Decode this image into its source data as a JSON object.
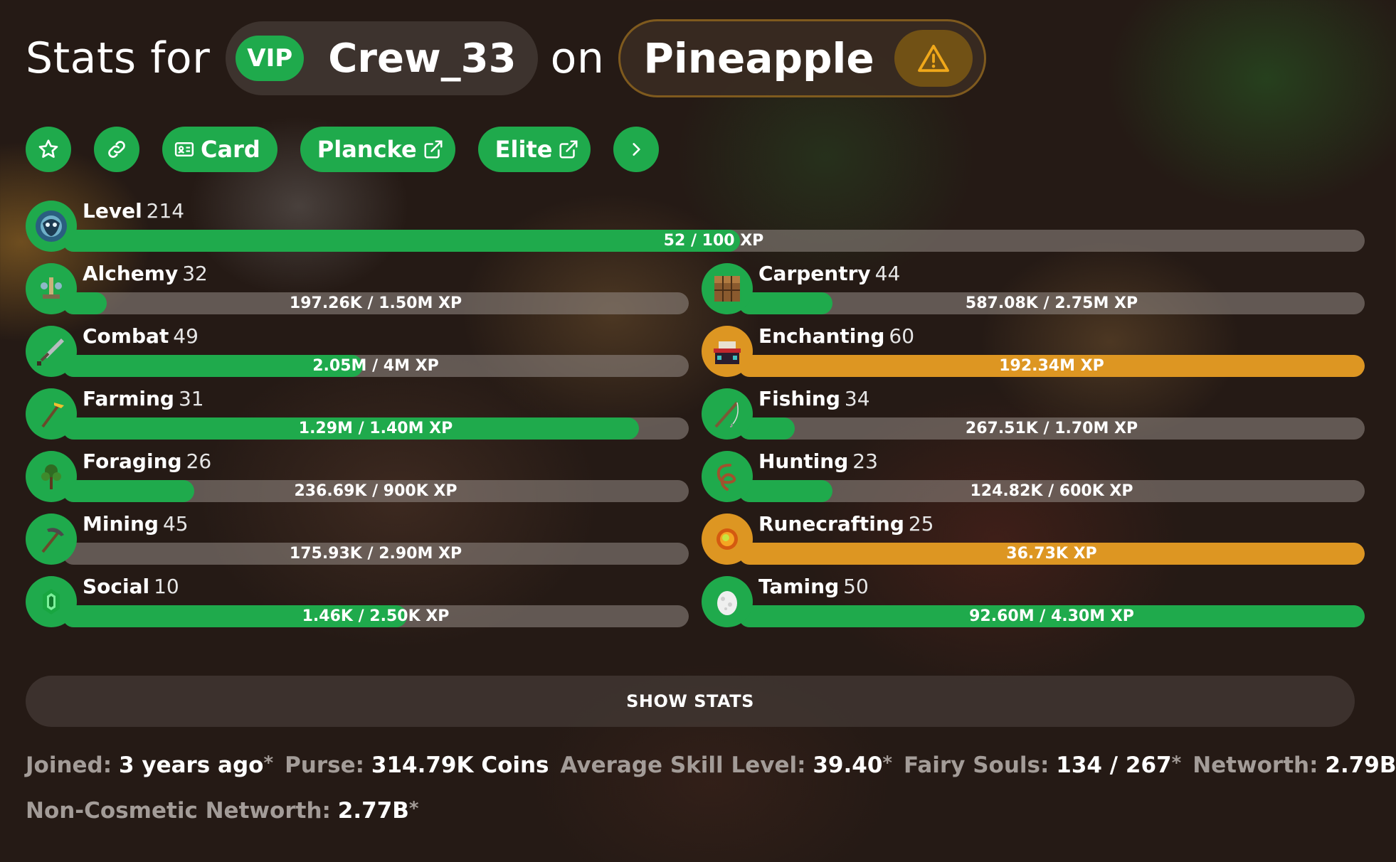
{
  "header": {
    "stats_for": "Stats for",
    "rank": "VIP",
    "player": "Crew_33",
    "on": "on",
    "profile": "Pineapple"
  },
  "actions": {
    "card": "Card",
    "plancke": "Plancke",
    "elite": "Elite"
  },
  "level": {
    "name": "Level",
    "value": "214",
    "xp": "52 / 100 XP",
    "progress": 0.52
  },
  "skills": [
    {
      "name": "Alchemy",
      "level": "32",
      "xp": "197.26K / 1.50M XP",
      "progress": 0.07,
      "color": "#1faa4c",
      "icon": "brewing-stand-icon"
    },
    {
      "name": "Carpentry",
      "level": "44",
      "xp": "587.08K / 2.75M XP",
      "progress": 0.15,
      "color": "#1faa4c",
      "icon": "crafting-table-icon"
    },
    {
      "name": "Combat",
      "level": "49",
      "xp": "2.05M / 4M XP",
      "progress": 0.48,
      "color": "#1faa4c",
      "icon": "sword-icon"
    },
    {
      "name": "Enchanting",
      "level": "60",
      "xp": "192.34M XP",
      "progress": 1.0,
      "color": "#dd9622",
      "icon": "enchanting-table-icon"
    },
    {
      "name": "Farming",
      "level": "31",
      "xp": "1.29M / 1.40M XP",
      "progress": 0.92,
      "color": "#1faa4c",
      "icon": "golden-hoe-icon"
    },
    {
      "name": "Fishing",
      "level": "34",
      "xp": "267.51K / 1.70M XP",
      "progress": 0.09,
      "color": "#1faa4c",
      "icon": "fishing-rod-icon"
    },
    {
      "name": "Foraging",
      "level": "26",
      "xp": "236.69K / 900K XP",
      "progress": 0.21,
      "color": "#1faa4c",
      "icon": "sapling-icon"
    },
    {
      "name": "Hunting",
      "level": "23",
      "xp": "124.82K / 600K XP",
      "progress": 0.15,
      "color": "#1faa4c",
      "icon": "lead-icon"
    },
    {
      "name": "Mining",
      "level": "45",
      "xp": "175.93K / 2.90M XP",
      "progress": 0.0,
      "color": "#1faa4c",
      "icon": "pickaxe-icon"
    },
    {
      "name": "Runecrafting",
      "level": "25",
      "xp": "36.73K XP",
      "progress": 1.0,
      "color": "#dd9622",
      "icon": "magma-cream-icon"
    },
    {
      "name": "Social",
      "level": "10",
      "xp": "1.46K / 2.50K XP",
      "progress": 0.55,
      "color": "#1faa4c",
      "icon": "emerald-icon"
    },
    {
      "name": "Taming",
      "level": "50",
      "xp": "92.60M / 4.30M XP",
      "progress": 1.0,
      "color": "#1faa4c",
      "icon": "spawn-egg-icon"
    }
  ],
  "show_stats": "SHOW STATS",
  "footer": {
    "joined_label": "Joined:",
    "joined": "3 years ago",
    "purse_label": "Purse:",
    "purse": "314.79K Coins",
    "avg_label": "Average Skill Level:",
    "avg": "39.40",
    "fairy_label": "Fairy Souls:",
    "fairy": "134 / 267",
    "networth_label": "Networth:",
    "networth": "2.79B",
    "noncos_label": "Non-Cosmetic Networth:",
    "noncos": "2.77B",
    "asterisk": "*"
  },
  "colors": {
    "accent": "#1faa4c",
    "maxed": "#dd9622",
    "warning": "#f0a81a"
  }
}
